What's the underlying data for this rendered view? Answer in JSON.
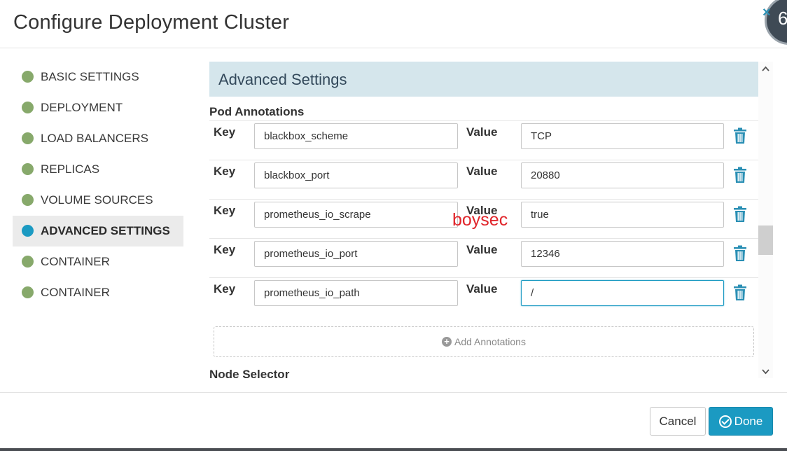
{
  "modal": {
    "title": "Configure Deployment Cluster",
    "corner_badge": "6"
  },
  "sidebar": {
    "items": [
      {
        "label": "BASIC SETTINGS",
        "status": "complete"
      },
      {
        "label": "DEPLOYMENT",
        "status": "complete"
      },
      {
        "label": "LOAD BALANCERS",
        "status": "complete"
      },
      {
        "label": "REPLICAS",
        "status": "complete"
      },
      {
        "label": "VOLUME SOURCES",
        "status": "complete"
      },
      {
        "label": "ADVANCED SETTINGS",
        "status": "active"
      },
      {
        "label": "CONTAINER",
        "status": "complete"
      },
      {
        "label": "CONTAINER",
        "status": "complete"
      }
    ]
  },
  "main": {
    "section_title": "Advanced Settings",
    "pod_annotations_title": "Pod Annotations",
    "key_label": "Key",
    "value_label": "Value",
    "annotations": [
      {
        "key": "blackbox_scheme",
        "value": "TCP"
      },
      {
        "key": "blackbox_port",
        "value": "20880"
      },
      {
        "key": "prometheus_io_scrape",
        "value": "true"
      },
      {
        "key": "prometheus_io_port",
        "value": "12346"
      },
      {
        "key": "prometheus_io_path",
        "value": "/"
      }
    ],
    "add_annotations_label": "Add Annotations",
    "node_selector_title": "Node Selector",
    "watermark": "boysec"
  },
  "footer": {
    "cancel_label": "Cancel",
    "done_label": "Done"
  },
  "colors": {
    "accent": "#1b9ac2",
    "complete_dot": "#87a96b",
    "section_band": "#d5e6ec",
    "watermark": "#e0242a"
  }
}
